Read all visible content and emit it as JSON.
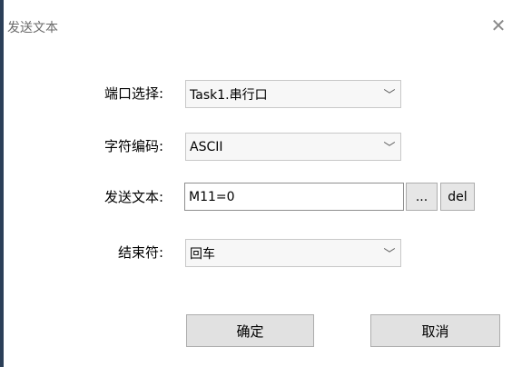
{
  "window": {
    "title": "发送文本"
  },
  "form": {
    "port": {
      "label": "端口选择:",
      "value": "Task1.串行口"
    },
    "encoding": {
      "label": "字符编码:",
      "value": "ASCII"
    },
    "send_text": {
      "label": "发送文本:",
      "value": "M11=0",
      "browse_label": "...",
      "del_label": "del"
    },
    "terminator": {
      "label": "结束符:",
      "value": "回车"
    }
  },
  "buttons": {
    "ok_label": "确定",
    "cancel_label": "取消"
  },
  "icons": {
    "close": "close-icon",
    "dropdown": "chevron-down-icon"
  }
}
